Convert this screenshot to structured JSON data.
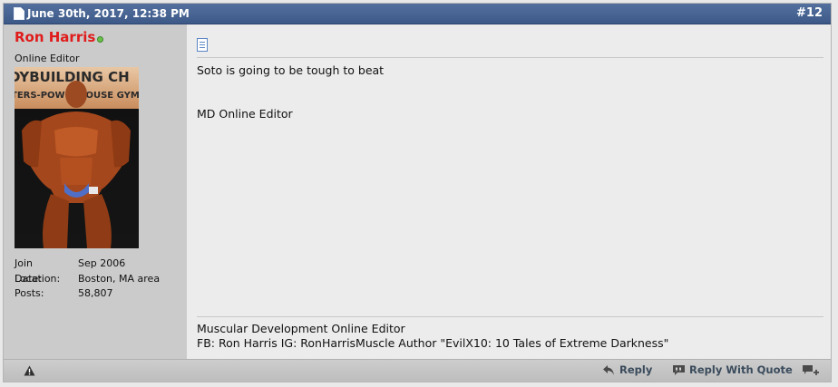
{
  "post": {
    "date": "June 30th, 2017, 12:38 PM",
    "number": "#12"
  },
  "user": {
    "name": "Ron Harris",
    "title": "Online Editor",
    "avatar_banner_text": "DYBUILDING CH\nTERS-POWERHOUSE GYMS",
    "stats": [
      {
        "label": "Join Date:",
        "value": "Sep 2006"
      },
      {
        "label": "Location:",
        "value": "Boston, MA area"
      },
      {
        "label": "Posts:",
        "value": "58,807"
      }
    ]
  },
  "message": {
    "line1": "Soto is going to be tough to beat",
    "line2": "MD Online Editor"
  },
  "signature": {
    "line1": "Muscular Development Online Editor",
    "line2": "FB: Ron Harris IG: RonHarrisMuscle Author \"EvilX10: 10 Tales of Extreme Darkness\""
  },
  "controls": {
    "reply": "Reply",
    "reply_with_quote": "Reply With Quote"
  }
}
